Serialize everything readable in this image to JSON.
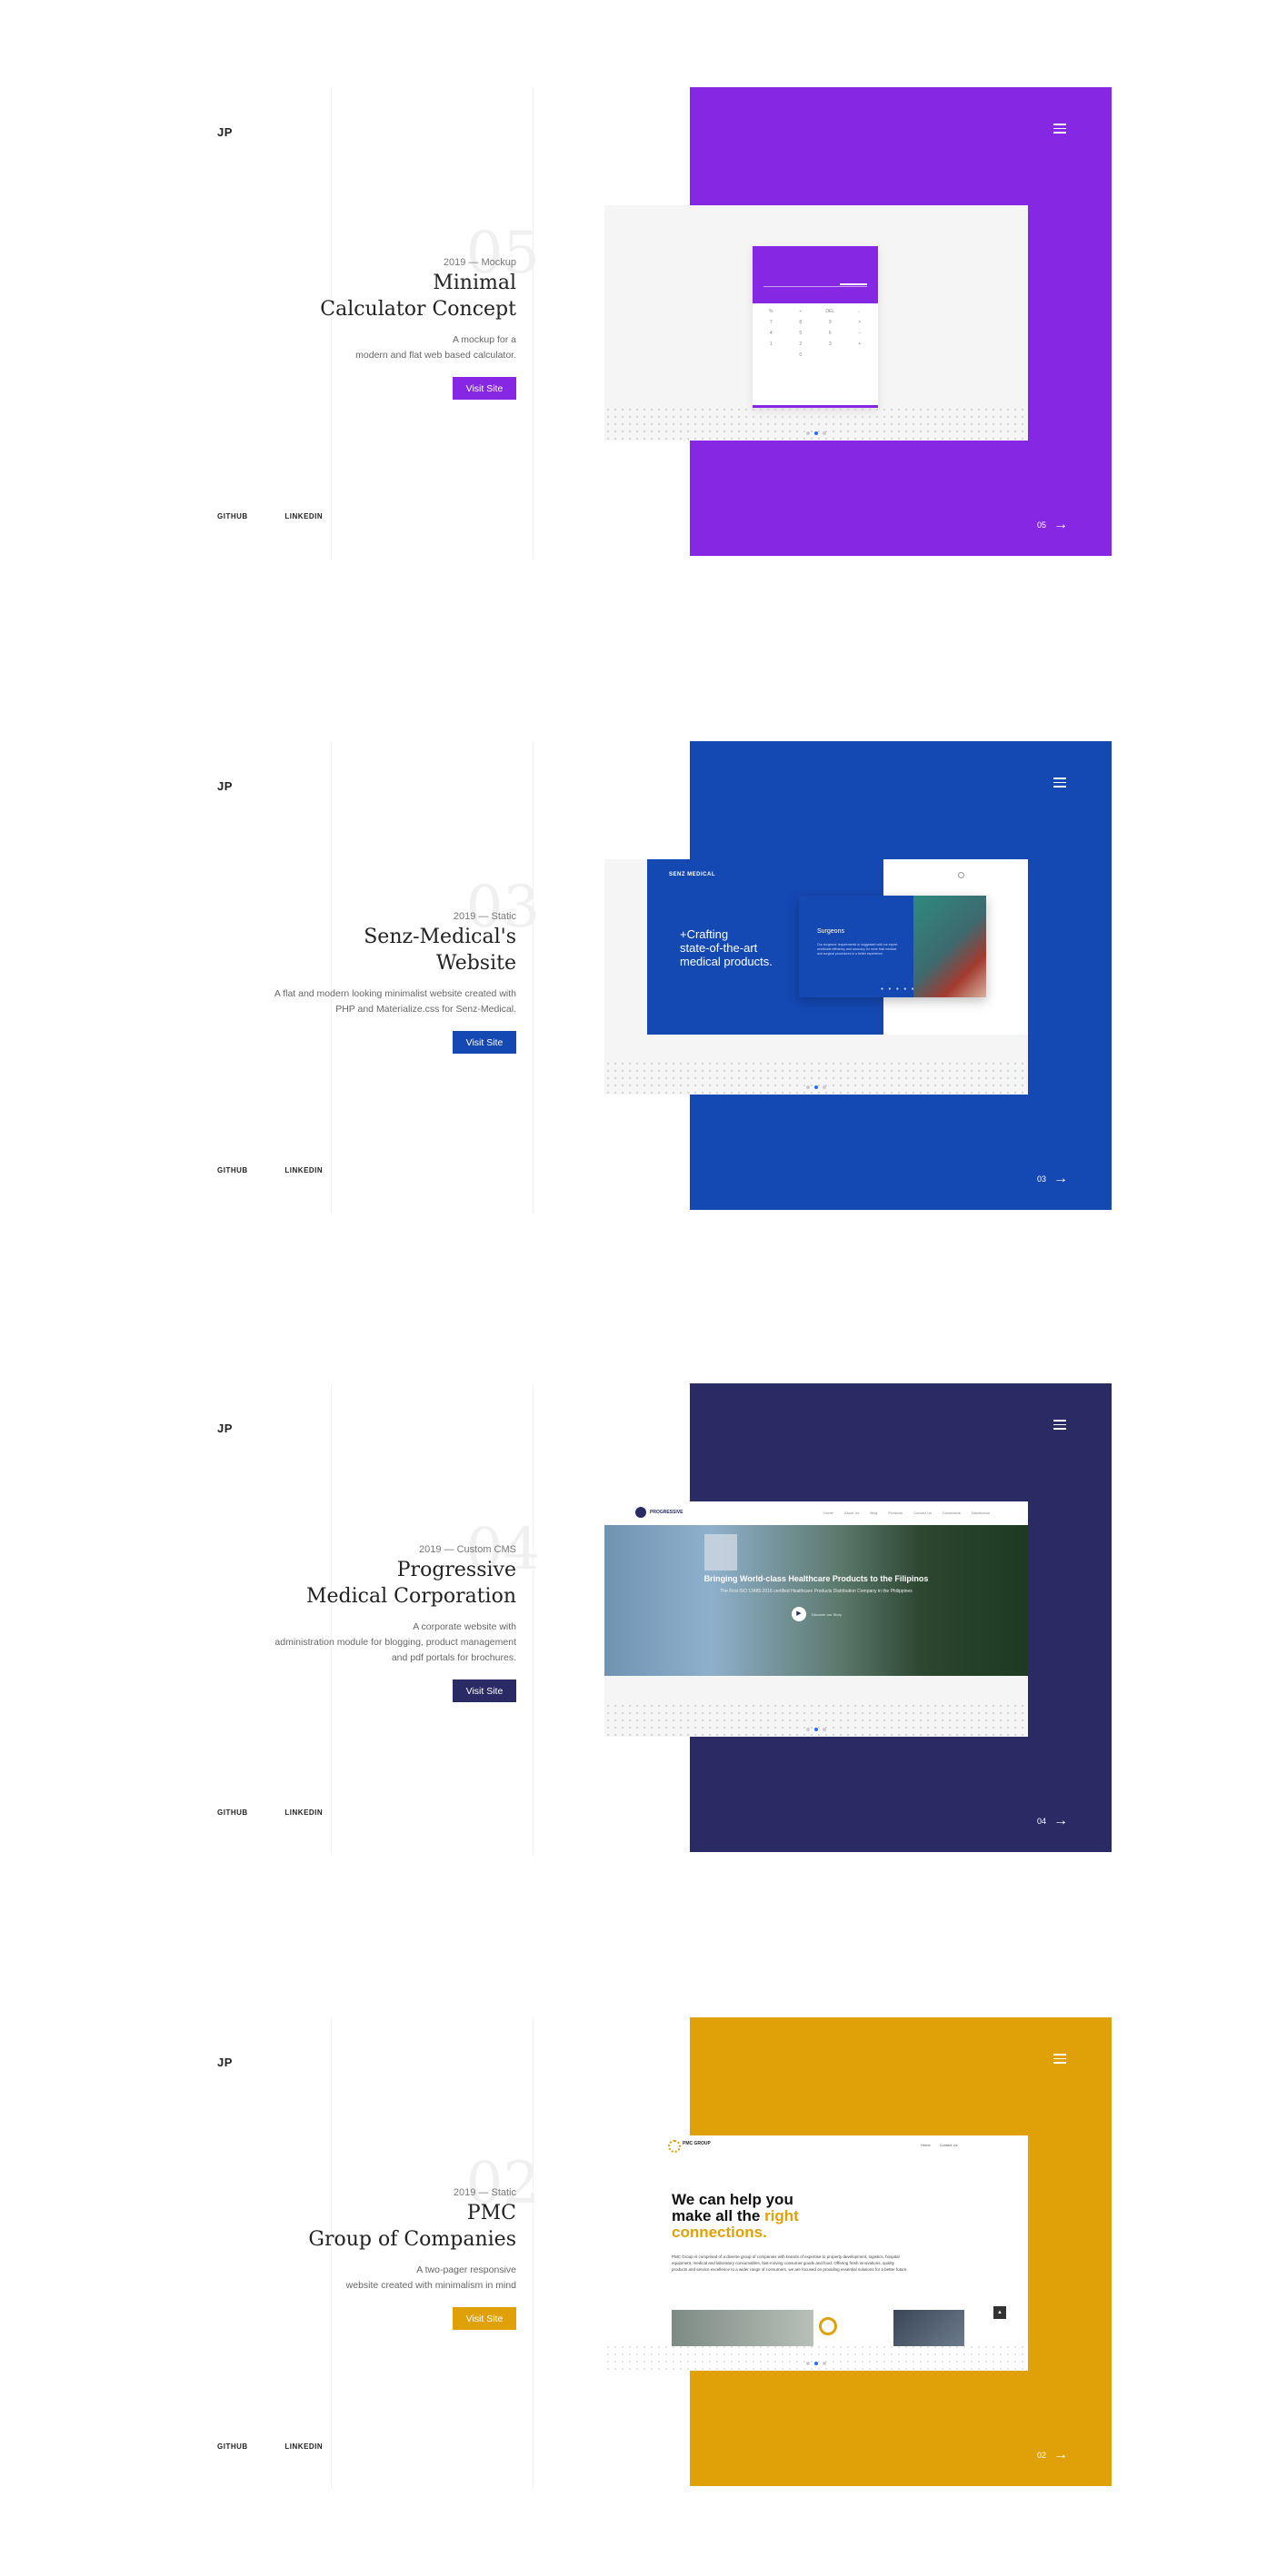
{
  "logo": "JP",
  "links": {
    "github": "GITHUB",
    "linkedin": "LINKEDIN"
  },
  "projects": [
    {
      "number": "05",
      "meta": "2019 — Mockup",
      "title_line1": "Minimal",
      "title_line2": "Calculator Concept",
      "desc_line1": "A mockup for a",
      "desc_line2": "modern and flat web based calculator.",
      "desc_line3": "",
      "button": "Visit Site",
      "counter": "05",
      "color": "#8527e3",
      "preview": {
        "keys": [
          "%",
          "÷",
          "DEL",
          "←",
          "7",
          "8",
          "9",
          "×",
          "4",
          "5",
          "6",
          "−",
          "1",
          "2",
          "3",
          "+",
          "0"
        ]
      }
    },
    {
      "number": "03",
      "meta": "2019 — Static",
      "title_line1": "Senz-Medical's",
      "title_line2": "Website",
      "desc_line1": "A flat and modern looking minimalist website created with",
      "desc_line2": "PHP and Materialize.css for Senz-Medical.",
      "desc_line3": "",
      "button": "Visit Site",
      "counter": "03",
      "color": "#1448b3",
      "preview": {
        "brand": "SENZ MEDICAL",
        "headline1": "+Crafting",
        "headline2": "state-of-the-art",
        "headline3": "medical products.",
        "card_title": "Surgeons",
        "card_text": "Our surgeons' requirements or suggested with our expert worldwide efficiency and accuracy for more fluid medical and surgical procedures in a better experience."
      }
    },
    {
      "number": "04",
      "meta": "2019 — Custom CMS",
      "title_line1": "Progressive",
      "title_line2": "Medical Corporation",
      "desc_line1": "A corporate website with",
      "desc_line2": "administration module for blogging, product management",
      "desc_line3": "and pdf portals for brochures.",
      "button": "Visit Site",
      "counter": "04",
      "color": "#2a2a65",
      "preview": {
        "brand": "PROGRESSIVE",
        "nav": [
          "Home",
          "About Us",
          "Blog",
          "Products",
          "Contact Us",
          "Downloads",
          "Distributors"
        ],
        "hero_title": "Bringing World-class Healthcare Products to the Filipinos",
        "hero_sub": "The First ISO 13485:2016 certified Healthcare Products Distribution Company in the Philippines",
        "play_label": "Discover our Story"
      }
    },
    {
      "number": "02",
      "meta": "2019 — Static",
      "title_line1": "PMC",
      "title_line2": "Group of Companies",
      "desc_line1": "A two-pager responsive",
      "desc_line2": "website created with minimalism in mind",
      "desc_line3": "",
      "button": "Visit Site",
      "counter": "02",
      "color": "#e0a108",
      "preview": {
        "brand": "PMC GROUP",
        "nav": [
          "Home",
          "Contact Us"
        ],
        "headline1": "We can help you",
        "headline2a": "make all the ",
        "headline2b": "right",
        "headline3": "connections.",
        "body": "PMC Group is comprised of a diverse group of companies with brands of expertise to property development, logistics, hospital equipment, medical and laboratory consumables, fast-moving consumer goods and food. Offering fresh innovations, quality products and service excellence to a wider range of consumers, we are focused on providing essential solutions for a better future."
      }
    }
  ]
}
